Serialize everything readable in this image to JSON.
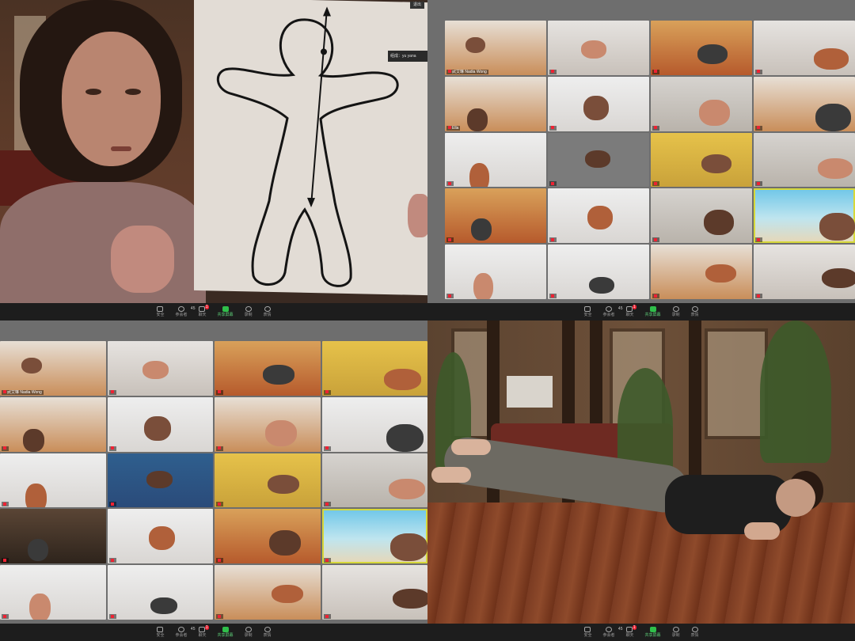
{
  "toolbar": {
    "items": [
      {
        "label": "安全",
        "icon": "shield-icon"
      },
      {
        "label": "参会者",
        "icon": "participants-icon",
        "count": "45"
      },
      {
        "label": "聊天",
        "icon": "chat-icon",
        "badge": "1"
      },
      {
        "label": "共享屏幕",
        "icon": "share-screen-icon"
      },
      {
        "label": "录制",
        "icon": "record-icon"
      },
      {
        "label": "表情",
        "icon": "reaction-icon"
      }
    ]
  },
  "speaker_view": {
    "tooltip": "组成：yu yana",
    "corner_button": "退出"
  },
  "gallery_top_right": {
    "tiles": [
      {
        "name": "武艾琳 Nadia Wong",
        "style": "t-warm"
      },
      {
        "name": "",
        "style": "t-face"
      },
      {
        "name": "",
        "style": "t-orange"
      },
      {
        "name": "",
        "style": "t-face"
      },
      {
        "name": "Ella",
        "style": "t-warm"
      },
      {
        "name": "",
        "style": "t-white"
      },
      {
        "name": "",
        "style": "t-room"
      },
      {
        "name": "",
        "style": "t-warm"
      },
      {
        "name": "",
        "style": "t-white"
      },
      {
        "name": "",
        "style": "t-grey"
      },
      {
        "name": "",
        "style": "t-yellow"
      },
      {
        "name": "",
        "style": "t-room"
      },
      {
        "name": "",
        "style": "t-orange"
      },
      {
        "name": "",
        "style": "t-white"
      },
      {
        "name": "",
        "style": "t-room"
      },
      {
        "name": "",
        "style": "t-beach"
      },
      {
        "name": "",
        "style": "t-white"
      },
      {
        "name": "",
        "style": "t-white"
      },
      {
        "name": "",
        "style": "t-warm"
      },
      {
        "name": "",
        "style": "t-face"
      }
    ]
  },
  "gallery_bottom_left": {
    "tiles": [
      {
        "name": "武艾琳 Nadia Wong",
        "style": "t-warm"
      },
      {
        "name": "",
        "style": "t-face"
      },
      {
        "name": "",
        "style": "t-orange"
      },
      {
        "name": "",
        "style": "t-yellow"
      },
      {
        "name": "",
        "style": "t-warm"
      },
      {
        "name": "",
        "style": "t-white"
      },
      {
        "name": "",
        "style": "t-warm"
      },
      {
        "name": "",
        "style": "t-white"
      },
      {
        "name": "",
        "style": "t-white"
      },
      {
        "name": "",
        "style": "t-blue"
      },
      {
        "name": "",
        "style": "t-yellow"
      },
      {
        "name": "",
        "style": "t-room"
      },
      {
        "name": "",
        "style": "t-dark"
      },
      {
        "name": "",
        "style": "t-white"
      },
      {
        "name": "",
        "style": "t-orange"
      },
      {
        "name": "",
        "style": "t-beach"
      },
      {
        "name": "",
        "style": "t-white"
      },
      {
        "name": "",
        "style": "t-white"
      },
      {
        "name": "",
        "style": "t-warm"
      },
      {
        "name": "",
        "style": "t-face"
      }
    ]
  },
  "colors": {
    "share_green": "#2fbf4a",
    "active_outline": "#d6d83a",
    "mute_red": "#e22233",
    "toolbar_bg": "#1d1d1d"
  }
}
